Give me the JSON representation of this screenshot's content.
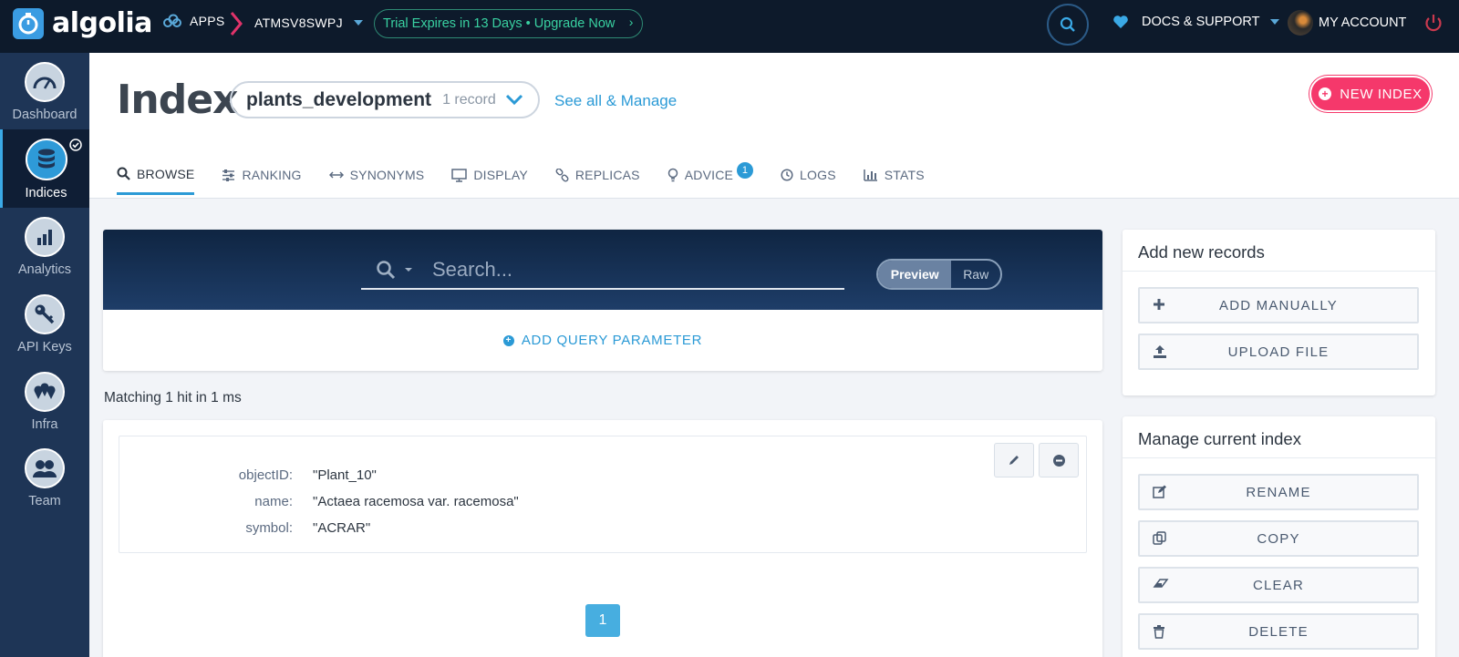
{
  "topbar": {
    "logo_text": "algolia",
    "apps_label": "APPS",
    "app_id": "ATMSV8SWPJ",
    "trial_label": "Trial Expires in 13 Days • Upgrade Now",
    "trial_arrow": "›",
    "docs_label": "DOCS & SUPPORT",
    "account_label": "MY ACCOUNT",
    "accent": "#39d1a1"
  },
  "sidebar": {
    "items": [
      {
        "label": "Dashboard",
        "icon": "gauge-icon"
      },
      {
        "label": "Indices",
        "icon": "database-icon",
        "active": true
      },
      {
        "label": "Analytics",
        "icon": "bar-chart-icon"
      },
      {
        "label": "API Keys",
        "icon": "key-icon"
      },
      {
        "label": "Infra",
        "icon": "map-pin-icon"
      },
      {
        "label": "Team",
        "icon": "people-icon"
      }
    ]
  },
  "header": {
    "title": "Index",
    "index_name": "plants_development",
    "record_count": "1 record",
    "see_all": "See all & Manage",
    "new_index": "NEW INDEX",
    "new_index_color": "#f5386b"
  },
  "tabs": [
    {
      "label": "BROWSE",
      "icon": "search-icon",
      "active": true
    },
    {
      "label": "RANKING",
      "icon": "sliders-icon"
    },
    {
      "label": "SYNONYMS",
      "icon": "arrows-icon"
    },
    {
      "label": "DISPLAY",
      "icon": "monitor-icon"
    },
    {
      "label": "REPLICAS",
      "icon": "link-icon"
    },
    {
      "label": "ADVICE",
      "icon": "bulb-icon",
      "badge": "1"
    },
    {
      "label": "LOGS",
      "icon": "clock-icon"
    },
    {
      "label": "STATS",
      "icon": "stats-icon"
    }
  ],
  "search": {
    "placeholder": "Search...",
    "preview_label": "Preview",
    "raw_label": "Raw",
    "add_param": "ADD QUERY PARAMETER"
  },
  "results": {
    "matching": "Matching 1 hit in 1 ms",
    "record": [
      {
        "key": "objectID:",
        "value": "\"Plant_10\""
      },
      {
        "key": "name:",
        "value": "\"Actaea racemosa var. racemosa\""
      },
      {
        "key": "symbol:",
        "value": "\"ACRAR\""
      }
    ],
    "page": "1"
  },
  "add_records": {
    "title": "Add new records",
    "buttons": [
      "ADD MANUALLY",
      "UPLOAD FILE"
    ]
  },
  "manage": {
    "title": "Manage current index",
    "buttons": [
      "RENAME",
      "COPY",
      "CLEAR",
      "DELETE"
    ]
  }
}
